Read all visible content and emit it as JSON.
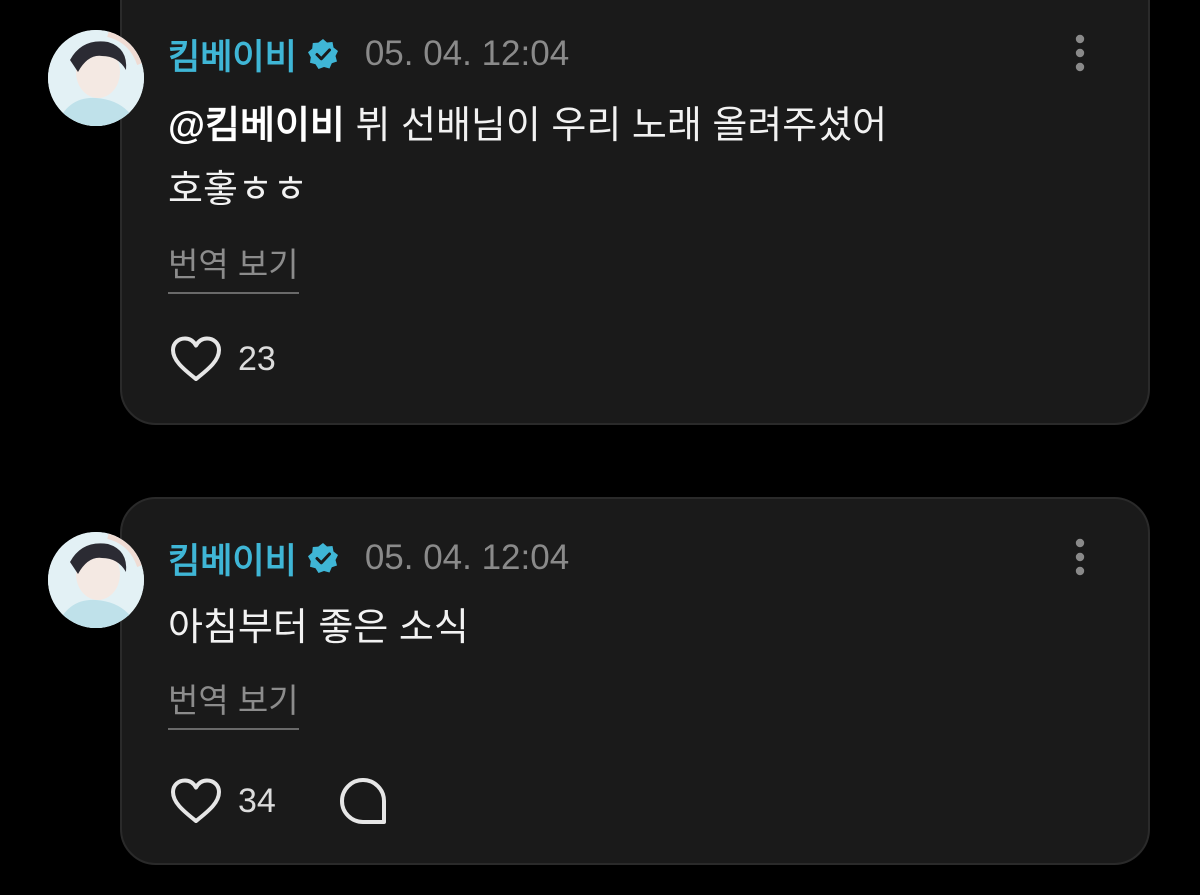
{
  "posts": [
    {
      "username": "킴베이비",
      "timestamp": "05. 04. 12:04",
      "mention": "@킴베이비",
      "text_line1": " 뷔 선배님이 우리 노래 올려주셨어",
      "text_line2": "호홓ㅎㅎ",
      "translate_label": "번역 보기",
      "like_count": "23",
      "icons": [
        "verified-badge-icon",
        "more-vertical-icon",
        "heart-icon"
      ]
    },
    {
      "username": "킴베이비",
      "timestamp": "05. 04. 12:04",
      "text_line1": "아침부터 좋은 소식",
      "translate_label": "번역 보기",
      "like_count": "34",
      "icons": [
        "verified-badge-icon",
        "more-vertical-icon",
        "heart-icon",
        "comment-icon"
      ]
    }
  ],
  "colors": {
    "background": "#000000",
    "card": "#1a1a1a",
    "username": "#3fb6d6",
    "verified": "#3fb6d6",
    "timestamp": "#8a8a8a",
    "text": "#f2f2f2"
  }
}
